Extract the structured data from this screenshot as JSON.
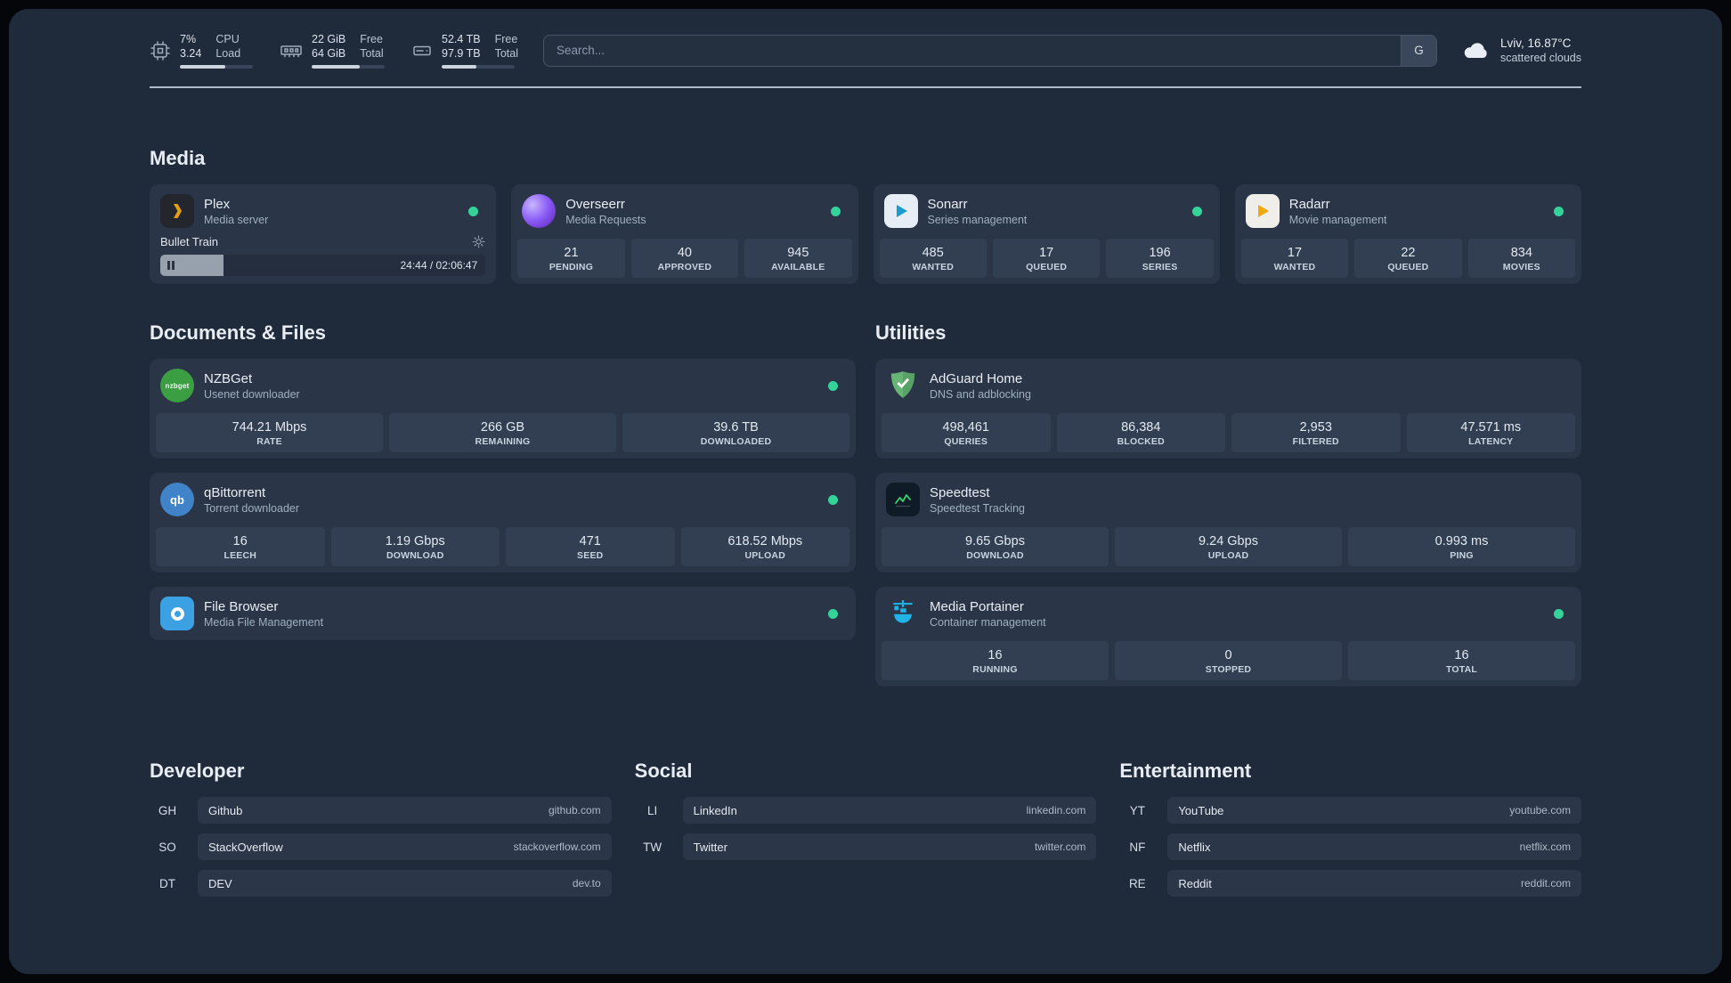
{
  "topbar": {
    "cpu": {
      "usage": "7%",
      "load": "3.24",
      "labels": [
        "CPU",
        "Load"
      ],
      "bar_percent": 62
    },
    "memory": {
      "free": "22 GiB",
      "total": "64 GiB",
      "labels": [
        "Free",
        "Total"
      ],
      "bar_percent": 66
    },
    "disk": {
      "free": "52.4 TB",
      "total": "97.9 TB",
      "labels": [
        "Free",
        "Total"
      ],
      "bar_percent": 47
    },
    "search": {
      "placeholder": "Search...",
      "provider_button": "G"
    },
    "weather": {
      "location": "Lviv, 16.87°C",
      "condition": "scattered clouds"
    }
  },
  "icons": {
    "nzbget_label": "nzbget",
    "qbittorrent_label": "qb"
  },
  "sections": {
    "media": {
      "title": "Media",
      "cards": [
        {
          "title": "Plex",
          "subtitle": "Media server",
          "status": "online",
          "now_playing": {
            "track": "Bullet Train",
            "time": "24:44 / 02:06:47",
            "progress_percent": 19.5
          }
        },
        {
          "title": "Overseerr",
          "subtitle": "Media Requests",
          "status": "online",
          "stats": [
            {
              "value": "21",
              "label": "PENDING"
            },
            {
              "value": "40",
              "label": "APPROVED"
            },
            {
              "value": "945",
              "label": "AVAILABLE"
            }
          ]
        },
        {
          "title": "Sonarr",
          "subtitle": "Series management",
          "status": "online",
          "stats": [
            {
              "value": "485",
              "label": "WANTED"
            },
            {
              "value": "17",
              "label": "QUEUED"
            },
            {
              "value": "196",
              "label": "SERIES"
            }
          ]
        },
        {
          "title": "Radarr",
          "subtitle": "Movie management",
          "status": "online",
          "stats": [
            {
              "value": "17",
              "label": "WANTED"
            },
            {
              "value": "22",
              "label": "QUEUED"
            },
            {
              "value": "834",
              "label": "MOVIES"
            }
          ]
        }
      ]
    },
    "documents": {
      "title": "Documents & Files",
      "cards": [
        {
          "title": "NZBGet",
          "subtitle": "Usenet downloader",
          "status": "online",
          "stats": [
            {
              "value": "744.21 Mbps",
              "label": "RATE"
            },
            {
              "value": "266 GB",
              "label": "REMAINING"
            },
            {
              "value": "39.6 TB",
              "label": "DOWNLOADED"
            }
          ]
        },
        {
          "title": "qBittorrent",
          "subtitle": "Torrent downloader",
          "status": "online",
          "stats": [
            {
              "value": "16",
              "label": "LEECH"
            },
            {
              "value": "1.19 Gbps",
              "label": "DOWNLOAD"
            },
            {
              "value": "471",
              "label": "SEED"
            },
            {
              "value": "618.52 Mbps",
              "label": "UPLOAD"
            }
          ]
        },
        {
          "title": "File Browser",
          "subtitle": "Media File Management",
          "status": "online",
          "stats": []
        }
      ]
    },
    "utilities": {
      "title": "Utilities",
      "cards": [
        {
          "title": "AdGuard Home",
          "subtitle": "DNS and adblocking",
          "stats": [
            {
              "value": "498,461",
              "label": "QUERIES"
            },
            {
              "value": "86,384",
              "label": "BLOCKED"
            },
            {
              "value": "2,953",
              "label": "FILTERED"
            },
            {
              "value": "47.571 ms",
              "label": "LATENCY"
            }
          ]
        },
        {
          "title": "Speedtest",
          "subtitle": "Speedtest Tracking",
          "stats": [
            {
              "value": "9.65 Gbps",
              "label": "DOWNLOAD"
            },
            {
              "value": "9.24 Gbps",
              "label": "UPLOAD"
            },
            {
              "value": "0.993 ms",
              "label": "PING"
            }
          ]
        },
        {
          "title": "Media Portainer",
          "subtitle": "Container management",
          "status": "online",
          "stats": [
            {
              "value": "16",
              "label": "RUNNING"
            },
            {
              "value": "0",
              "label": "STOPPED"
            },
            {
              "value": "16",
              "label": "TOTAL"
            }
          ]
        }
      ]
    }
  },
  "bookmarks": [
    {
      "title": "Developer",
      "items": [
        {
          "abbr": "GH",
          "name": "Github",
          "domain": "github.com"
        },
        {
          "abbr": "SO",
          "name": "StackOverflow",
          "domain": "stackoverflow.com"
        },
        {
          "abbr": "DT",
          "name": "DEV",
          "domain": "dev.to"
        }
      ]
    },
    {
      "title": "Social",
      "items": [
        {
          "abbr": "LI",
          "name": "LinkedIn",
          "domain": "linkedin.com"
        },
        {
          "abbr": "TW",
          "name": "Twitter",
          "domain": "twitter.com"
        }
      ]
    },
    {
      "title": "Entertainment",
      "items": [
        {
          "abbr": "YT",
          "name": "YouTube",
          "domain": "youtube.com"
        },
        {
          "abbr": "NF",
          "name": "Netflix",
          "domain": "netflix.com"
        },
        {
          "abbr": "RE",
          "name": "Reddit",
          "domain": "reddit.com"
        }
      ]
    }
  ],
  "colors": {
    "status_online": "#34d399",
    "plex_accent": "#e5a00d",
    "overseerr_accent": "#7c3aed",
    "sonarr_accent": "#1b9ad2",
    "radarr_accent": "#f0a80b",
    "nzbget_accent": "#3c9e43",
    "qbittorrent_accent": "#4083c9",
    "filebrowser_accent": "#3ba1e3",
    "adguard_accent": "#66b574",
    "speedtest_accent": "#34d26b",
    "portainer_accent": "#1fb3e8"
  }
}
